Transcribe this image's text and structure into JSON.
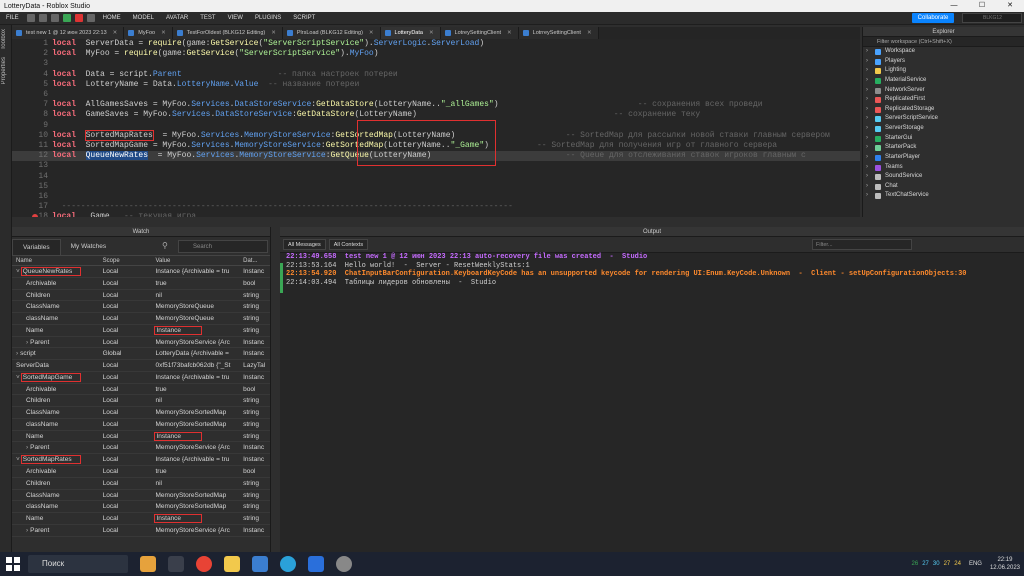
{
  "window": {
    "title": "LotteryData - Roblox Studio",
    "min": "—",
    "max": "☐",
    "close": "✕"
  },
  "menu": {
    "file": "FILE",
    "items": [
      "HOME",
      "MODEL",
      "AVATAR",
      "TEST",
      "VIEW",
      "PLUGINS",
      "SCRIPT"
    ],
    "collaborate": "Collaborate",
    "search": "BLKG12"
  },
  "side": {
    "toolbox": "Toolbox",
    "properties": "Properties"
  },
  "tabs": [
    {
      "label": "test new 1 @ 12 июн 2023 22:13"
    },
    {
      "label": "MyFoo"
    },
    {
      "label": "TestForOldest (BLKG12 Editing)"
    },
    {
      "label": "PlrsLoad (BLKG12 Editing)"
    },
    {
      "label": "LotteryData",
      "active": true
    },
    {
      "label": "LotreySettingClient"
    },
    {
      "label": "LotrreySettingClient"
    }
  ],
  "editor": {
    "lines": [
      {
        "n": "1",
        "t": [
          [
            "kw",
            "local"
          ],
          [
            "",
            "  ServerData = "
          ],
          [
            "fn",
            "require"
          ],
          [
            "",
            "(game:"
          ],
          [
            "fn",
            "GetService"
          ],
          [
            "",
            "("
          ],
          [
            "st",
            "\"ServerScriptService\""
          ],
          [
            "",
            ")."
          ],
          [
            "pr",
            "ServerLogic"
          ],
          [
            "",
            "."
          ],
          [
            "pr",
            "ServerLoad"
          ],
          [
            "",
            ")"
          ]
        ]
      },
      {
        "n": "2",
        "t": [
          [
            "kw",
            "local"
          ],
          [
            "",
            "  MyFoo = "
          ],
          [
            "fn",
            "require"
          ],
          [
            "",
            "(game:"
          ],
          [
            "fn",
            "GetService"
          ],
          [
            "",
            "("
          ],
          [
            "st",
            "\"ServerScriptService\""
          ],
          [
            "",
            ")."
          ],
          [
            "pr",
            "MyFoo"
          ],
          [
            "",
            ")"
          ]
        ]
      },
      {
        "n": "3",
        "t": []
      },
      {
        "n": "4",
        "t": [
          [
            "kw",
            "local"
          ],
          [
            "",
            "  Data = script."
          ],
          [
            "pr",
            "Parent"
          ],
          [
            "",
            "                    "
          ],
          [
            "cm",
            "-- папка настроек потереи"
          ]
        ]
      },
      {
        "n": "5",
        "t": [
          [
            "kw",
            "local"
          ],
          [
            "",
            "  LotteryName = Data."
          ],
          [
            "pr",
            "LotteryName"
          ],
          [
            "",
            "."
          ],
          [
            "pr",
            "Value"
          ],
          [
            "",
            "  "
          ],
          [
            "cm",
            "-- название потереи"
          ]
        ]
      },
      {
        "n": "6",
        "t": []
      },
      {
        "n": "7",
        "t": [
          [
            "kw",
            "local"
          ],
          [
            "",
            "  AllGamesSaves = MyFoo."
          ],
          [
            "pr",
            "Services"
          ],
          [
            "",
            "."
          ],
          [
            "pr",
            "DataStoreService"
          ],
          [
            "",
            ":"
          ],
          [
            "fn",
            "GetDataStore"
          ],
          [
            "",
            "(LotteryName.."
          ],
          [
            "st",
            "\"_allGames\""
          ],
          [
            "",
            ")"
          ],
          [
            "",
            "                             "
          ],
          [
            "cm",
            "-- сохранения всех проведи"
          ]
        ]
      },
      {
        "n": "8",
        "t": [
          [
            "kw",
            "local"
          ],
          [
            "",
            "  GameSaves = MyFoo."
          ],
          [
            "pr",
            "Services"
          ],
          [
            "",
            "."
          ],
          [
            "pr",
            "DataStoreService"
          ],
          [
            "",
            ":"
          ],
          [
            "fn",
            "GetDataStore"
          ],
          [
            "",
            "(LotteryName)"
          ],
          [
            "",
            "                                         "
          ],
          [
            "cm",
            "-- сохранение теку"
          ]
        ]
      },
      {
        "n": "9",
        "t": []
      },
      {
        "n": "10",
        "t": [
          [
            "kw",
            "local"
          ],
          [
            "",
            "  "
          ],
          [
            "box",
            "SortedMapRates"
          ],
          [
            "",
            "  = MyFoo."
          ],
          [
            "pr",
            "Services"
          ],
          [
            "",
            "."
          ],
          [
            "pr",
            "MemoryStoreService"
          ],
          [
            "",
            ":"
          ],
          [
            "fn",
            "GetSortedMap"
          ],
          [
            "",
            "(LotteryName)"
          ],
          [
            "",
            "                       "
          ],
          [
            "cm",
            "-- SortedMap для рассылки новой ставки главным сервером"
          ]
        ]
      },
      {
        "n": "11",
        "t": [
          [
            "kw",
            "local"
          ],
          [
            "",
            "  SortedMapGame = MyFoo."
          ],
          [
            "pr",
            "Services"
          ],
          [
            "",
            "."
          ],
          [
            "pr",
            "MemoryStoreService"
          ],
          [
            "",
            ":"
          ],
          [
            "fn",
            "GetSortedMap"
          ],
          [
            "",
            "(LotteryName.."
          ],
          [
            "st",
            "\"_Game\""
          ],
          [
            "",
            ")"
          ],
          [
            "",
            "          "
          ],
          [
            "cm",
            "-- SortedMap для получения игр от главного сервера"
          ]
        ]
      },
      {
        "n": "12",
        "t": [
          [
            "kw",
            "local"
          ],
          [
            "",
            "  "
          ],
          [
            "sel",
            "QueueNewRates"
          ],
          [
            "",
            "  = MyFoo."
          ],
          [
            "pr",
            "Services"
          ],
          [
            "",
            "."
          ],
          [
            "pr",
            "MemoryStoreService"
          ],
          [
            "",
            ":"
          ],
          [
            "fn",
            "GetQueue"
          ],
          [
            "",
            "(LotteryName)"
          ],
          [
            "",
            "                            "
          ],
          [
            "cm",
            "-- Queue для отслеживания ставок игроков главным с"
          ]
        ],
        "hl": true
      },
      {
        "n": "13",
        "t": []
      },
      {
        "n": "14",
        "t": []
      },
      {
        "n": "15",
        "t": []
      },
      {
        "n": "16",
        "t": []
      },
      {
        "n": "17",
        "t": [
          [
            "cm",
            "  ----------------------------------------------------------------------------------------------"
          ]
        ]
      },
      {
        "n": "18",
        "t": [
          [
            "kw",
            "local"
          ],
          [
            "",
            "  _Game   "
          ],
          [
            "cm",
            "-- текущая игра"
          ]
        ]
      }
    ]
  },
  "watch": {
    "title": "Watch",
    "tabs": [
      "Variables",
      "My Watches"
    ],
    "search": "Search",
    "headers": [
      "Name",
      "Scope",
      "Value",
      "Dat..."
    ],
    "rows": [
      {
        "name": "QueueNewRates",
        "scope": "Local",
        "value": "Instance {Archivable = tru",
        "type": "Instanc",
        "lvl": 0,
        "exp": "˅",
        "box": true
      },
      {
        "name": "Archivable",
        "scope": "Local",
        "value": "true",
        "type": "bool",
        "lvl": 1
      },
      {
        "name": "Children",
        "scope": "Local",
        "value": "nil",
        "type": "string",
        "lvl": 1
      },
      {
        "name": "ClassName",
        "scope": "Local",
        "value": "MemoryStoreQueue",
        "type": "string",
        "lvl": 1
      },
      {
        "name": "className",
        "scope": "Local",
        "value": "MemoryStoreQueue",
        "type": "string",
        "lvl": 1
      },
      {
        "name": "Name",
        "scope": "Local",
        "value": "Instance",
        "type": "string",
        "lvl": 1,
        "vbox": true
      },
      {
        "name": "Parent",
        "scope": "Local",
        "value": "MemoryStoreService {Arc",
        "type": "Instanc",
        "lvl": 1,
        "exp": "›"
      },
      {
        "name": "script",
        "scope": "Global",
        "value": "LotteryData {Archivable =",
        "type": "Instanc",
        "lvl": 0,
        "exp": "›"
      },
      {
        "name": "ServerData",
        "scope": "Local",
        "value": "0xf51f73bafcb062db {\"_St",
        "type": "LazyTal",
        "lvl": 0
      },
      {
        "name": "SortedMapGame",
        "scope": "Local",
        "value": "Instance {Archivable = tru",
        "type": "Instanc",
        "lvl": 0,
        "exp": "˅",
        "box": true
      },
      {
        "name": "Archivable",
        "scope": "Local",
        "value": "true",
        "type": "bool",
        "lvl": 1
      },
      {
        "name": "Children",
        "scope": "Local",
        "value": "nil",
        "type": "string",
        "lvl": 1
      },
      {
        "name": "ClassName",
        "scope": "Local",
        "value": "MemoryStoreSortedMap",
        "type": "string",
        "lvl": 1
      },
      {
        "name": "className",
        "scope": "Local",
        "value": "MemoryStoreSortedMap",
        "type": "string",
        "lvl": 1
      },
      {
        "name": "Name",
        "scope": "Local",
        "value": "Instance",
        "type": "string",
        "lvl": 1,
        "vbox": true
      },
      {
        "name": "Parent",
        "scope": "Local",
        "value": "MemoryStoreService {Arc",
        "type": "Instanc",
        "lvl": 1,
        "exp": "›"
      },
      {
        "name": "SortedMapRates",
        "scope": "Local",
        "value": "Instance {Archivable = tru",
        "type": "Instanc",
        "lvl": 0,
        "exp": "˅",
        "box": true
      },
      {
        "name": "Archivable",
        "scope": "Local",
        "value": "true",
        "type": "bool",
        "lvl": 1
      },
      {
        "name": "Children",
        "scope": "Local",
        "value": "nil",
        "type": "string",
        "lvl": 1
      },
      {
        "name": "ClassName",
        "scope": "Local",
        "value": "MemoryStoreSortedMap",
        "type": "string",
        "lvl": 1
      },
      {
        "name": "className",
        "scope": "Local",
        "value": "MemoryStoreSortedMap",
        "type": "string",
        "lvl": 1
      },
      {
        "name": "Name",
        "scope": "Local",
        "value": "Instance",
        "type": "string",
        "lvl": 1,
        "vbox": true
      },
      {
        "name": "Parent",
        "scope": "Local",
        "value": "MemoryStoreService {Arc",
        "type": "Instanc",
        "lvl": 1,
        "exp": "›"
      }
    ]
  },
  "output": {
    "title": "Output",
    "messages": "All Messages",
    "contexts": "All Contexts",
    "filter": "Filter...",
    "lines": [
      {
        "text": "22:13:49.658  test new 1 @ 12 июн 2023 22:13 auto-recovery file was created  -  Studio",
        "cls": "purple"
      },
      {
        "text": "22:13:53.164  Hello world!  -  Server - ResetWeeklyStats:1",
        "cls": ""
      },
      {
        "text": "22:13:54.920  ChatInputBarConfiguration.KeyboardKeyCode has an unsupported keycode for rendering UI:Enum.KeyCode.Unknown  -  Client - setUpConfigurationObjects:30",
        "cls": "orange"
      },
      {
        "text": "22:14:03.494  Таблицы лидеров обновлены  -  Studio",
        "cls": ""
      }
    ]
  },
  "explorer": {
    "title": "Explorer",
    "filter": "Filter workspace (Ctrl+Shift+X)",
    "items": [
      {
        "label": "Workspace",
        "color": "#4aa3ff"
      },
      {
        "label": "Players",
        "color": "#4aa3ff"
      },
      {
        "label": "Lighting",
        "color": "#f2c94c"
      },
      {
        "label": "MaterialService",
        "color": "#27ae60"
      },
      {
        "label": "NetworkServer",
        "color": "#8e8e8e"
      },
      {
        "label": "ReplicatedFirst",
        "color": "#eb5757"
      },
      {
        "label": "ReplicatedStorage",
        "color": "#eb5757"
      },
      {
        "label": "ServerScriptService",
        "color": "#56ccf2"
      },
      {
        "label": "ServerStorage",
        "color": "#56ccf2"
      },
      {
        "label": "StarterGui",
        "color": "#27ae60"
      },
      {
        "label": "StarterPack",
        "color": "#6fcf97"
      },
      {
        "label": "StarterPlayer",
        "color": "#2f80ed"
      },
      {
        "label": "Teams",
        "color": "#9b51e0"
      },
      {
        "label": "SoundService",
        "color": "#bdbdbd"
      },
      {
        "label": "Chat",
        "color": "#bdbdbd"
      },
      {
        "label": "TextChatService",
        "color": "#bdbdbd"
      }
    ]
  },
  "taskbar": {
    "search": "Поиск",
    "lang": "ENG",
    "time": "22:19",
    "date": "12.06.2023",
    "tray": [
      "26",
      "27",
      "30",
      "27",
      "24"
    ]
  }
}
